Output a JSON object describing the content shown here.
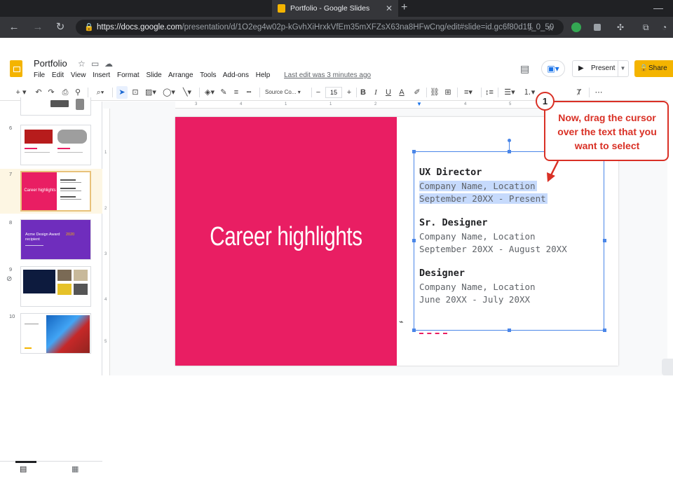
{
  "browser": {
    "tab_title": "Portfolio - Google Slides",
    "url_host": "https://docs.google.com",
    "url_path": "/presentation/d/1O2eg4w02p-kGvhXiHrxkVfEm35mXFZsX63na8HFwCng/edit#slide=id.gc6f80d1ff_0_50"
  },
  "doc": {
    "title": "Portfolio",
    "menus": [
      "File",
      "Edit",
      "View",
      "Insert",
      "Format",
      "Slide",
      "Arrange",
      "Tools",
      "Add-ons",
      "Help"
    ],
    "last_edit": "Last edit was 3 minutes ago",
    "present_label": "Present",
    "share_label": "Share"
  },
  "toolbar": {
    "font_name": "Source Co...",
    "font_size": "15"
  },
  "filmstrip": {
    "slide_numbers": [
      "6",
      "7",
      "8",
      "9",
      "10"
    ],
    "slide7_title": "Career highlights",
    "slide8_title": "Acme Design Award recipient",
    "slide8_year": "2020"
  },
  "slide": {
    "title": "Career highlights",
    "jobs": [
      {
        "role": "UX Director",
        "company": "Company Name, Location",
        "dates": "September 20XX - Present"
      },
      {
        "role": "Sr. Designer",
        "company": "Company Name, Location",
        "dates": "September 20XX - August 20XX"
      },
      {
        "role": "Designer",
        "company": "Company Name, Location",
        "dates": "June 20XX - July 20XX"
      }
    ]
  },
  "annotation": {
    "number": "1",
    "text": "Now, drag the cursor over the text that you want to select",
    "color": "#d93025"
  },
  "colors": {
    "slide_accent": "#e91e63",
    "selection": "#c6dafc",
    "share_button": "#f4b400"
  }
}
